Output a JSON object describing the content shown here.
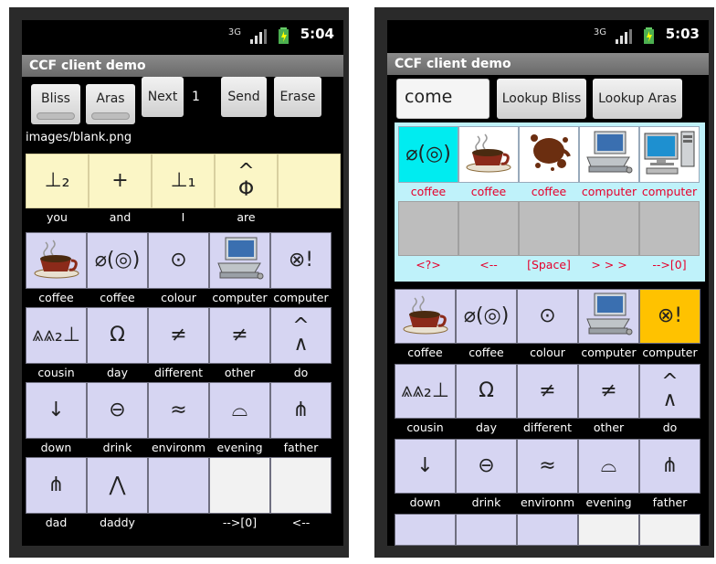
{
  "left": {
    "status_time": "5:04",
    "title": "CCF client demo",
    "buttons": [
      "Bliss",
      "Aras",
      "Next",
      "1",
      "Send",
      "Erase"
    ],
    "image_path": "images/blank.png",
    "sentence": [
      {
        "label": "you",
        "glyph": "⊥₂"
      },
      {
        "label": "and",
        "glyph": "+"
      },
      {
        "label": "I",
        "glyph": "⊥₁"
      },
      {
        "label": "are",
        "glyph": "^\nΦ"
      },
      {
        "label": "",
        "glyph": ""
      }
    ],
    "grid": [
      {
        "label": "coffee",
        "icon": "coffee-cup-icon"
      },
      {
        "label": "coffee",
        "glyph": "⌀(◎)"
      },
      {
        "label": "colour",
        "glyph": "⊙"
      },
      {
        "label": "computer",
        "icon": "computer-icon"
      },
      {
        "label": "computer",
        "glyph": "⊗!"
      },
      {
        "label": "cousin",
        "glyph": "⩓⩓₂⊥"
      },
      {
        "label": "day",
        "glyph": "Ω"
      },
      {
        "label": "different",
        "glyph": "≠"
      },
      {
        "label": "other",
        "glyph": "≠"
      },
      {
        "label": "do",
        "glyph": "^\n∧"
      },
      {
        "label": "down",
        "glyph": "↓"
      },
      {
        "label": "drink",
        "glyph": "⊖"
      },
      {
        "label": "environm",
        "glyph": "≈"
      },
      {
        "label": "evening",
        "glyph": "⌓"
      },
      {
        "label": "father",
        "glyph": "⋔"
      },
      {
        "label": "dad",
        "glyph": "⋔"
      },
      {
        "label": "daddy",
        "glyph": "⋀"
      },
      {
        "label": "",
        "glyph": ""
      },
      {
        "label": "-->[0]",
        "glyph": ""
      },
      {
        "label": "<--",
        "glyph": ""
      }
    ]
  },
  "right": {
    "status_time": "5:03",
    "title": "CCF client demo",
    "search_value": "come",
    "buttons": [
      "Lookup Bliss",
      "Lookup Aras"
    ],
    "lookup_results": [
      {
        "label": "coffee",
        "glyph": "⌀(◎)"
      },
      {
        "label": "coffee",
        "icon": "coffee-cup-icon"
      },
      {
        "label": "coffee",
        "icon": "coffee-stain-icon"
      },
      {
        "label": "computer",
        "icon": "laptop-icon"
      },
      {
        "label": "computer",
        "icon": "desktop-icon"
      }
    ],
    "controls": [
      "<?>",
      "<--",
      "[Space]",
      "> > >",
      "-->[0]"
    ],
    "grid": [
      {
        "label": "coffee",
        "icon": "coffee-cup-icon"
      },
      {
        "label": "coffee",
        "glyph": "⌀(◎)"
      },
      {
        "label": "colour",
        "glyph": "⊙"
      },
      {
        "label": "computer",
        "icon": "computer-icon"
      },
      {
        "label": "computer",
        "glyph": "⊗!"
      },
      {
        "label": "cousin",
        "glyph": "⩓⩓₂⊥"
      },
      {
        "label": "day",
        "glyph": "Ω"
      },
      {
        "label": "different",
        "glyph": "≠"
      },
      {
        "label": "other",
        "glyph": "≠"
      },
      {
        "label": "do",
        "glyph": "^\n∧"
      },
      {
        "label": "down",
        "glyph": "↓"
      },
      {
        "label": "drink",
        "glyph": "⊖"
      },
      {
        "label": "environm",
        "glyph": "≈"
      },
      {
        "label": "evening",
        "glyph": "⌓"
      },
      {
        "label": "father",
        "glyph": "⋔"
      }
    ]
  },
  "colors": {
    "sentence_bg": "#fbf6c6",
    "grid_bg": "#d6d5f2",
    "lookup_bg": "#bff2fa",
    "highlight_cyan": "#00ecf0",
    "highlight_orange": "#ffc200",
    "red_label": "#e6002c"
  }
}
